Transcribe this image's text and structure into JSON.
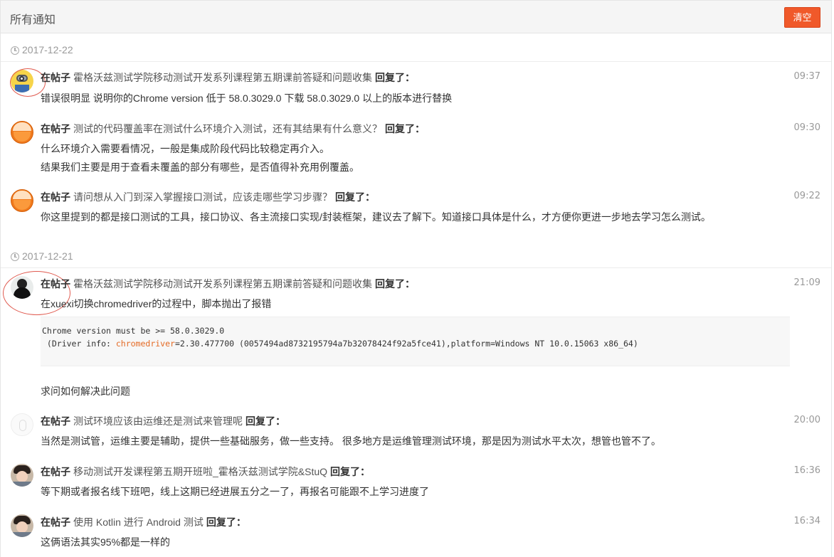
{
  "header": {
    "title": "所有通知",
    "clear_label": "清空"
  },
  "groups": [
    {
      "date": "2017-12-22"
    },
    {
      "date": "2017-12-21"
    }
  ],
  "notifications": [
    {
      "where": "在帖子",
      "topic": "霍格沃兹测试学院移动测试开发系列课程第五期课前答疑和问题收集",
      "verb": "回复了：",
      "time": "09:37",
      "reply": [
        "错误很明显 说明你的Chrome version 低于 58.0.3029.0 下载 58.0.3029.0 以上的版本进行替换"
      ],
      "avatar": "minion-avatar"
    },
    {
      "where": "在帖子",
      "topic": "测试的代码覆盖率在测试什么环境介入测试，还有其结果有什么意义？",
      "verb": "回复了：",
      "time": "09:30",
      "reply": [
        "什么环境介入需要看情况，一般是集成阶段代码比较稳定再介入。",
        "结果我们主要是用于查看未覆盖的部分有哪些，是否值得补充用例覆盖。"
      ],
      "avatar": "orange-avatar"
    },
    {
      "where": "在帖子",
      "topic": "请问想从入门到深入掌握接口测试，应该走哪些学习步骤？",
      "verb": "回复了：",
      "time": "09:22",
      "reply": [
        "你这里提到的都是接口测试的工具，接口协议、各主流接口实现/封装框架，建议去了解下。知道接口具体是什么，才方便你更进一步地去学习怎么测试。"
      ],
      "avatar": "orange-avatar"
    },
    {
      "where": "在帖子",
      "topic": "霍格沃兹测试学院移动测试开发系列课程第五期课前答疑和问题收集",
      "verb": "回复了：",
      "time": "21:09",
      "reply": [
        "在xuexi切换chromedriver的过程中，脚本抛出了报错"
      ],
      "code": {
        "line1": "Chrome version must be >= 58.0.3029.0",
        "line2_prefix": " (Driver info: ",
        "line2_keyword": "chromedriver",
        "line2_suffix": "=2.30.477700 (0057494ad8732195794a7b32078424f92a5fce41),platform=Windows NT 10.0.15063 x86_64)"
      },
      "reply_after": "求问如何解决此问题",
      "avatar": "dark-avatar"
    },
    {
      "where": "在帖子",
      "topic": "测试环境应该由运维还是测试来管理呢",
      "verb": "回复了：",
      "time": "20:00",
      "reply": [
        "当然是测试管，运维主要是辅助，提供一些基础服务，做一些支持。 很多地方是运维管理测试环境，那是因为测试水平太次，想管也管不了。"
      ],
      "avatar": "blank-avatar"
    },
    {
      "where": "在帖子",
      "topic": "移动测试开发课程第五期开班啦_霍格沃兹测试学院&StuQ",
      "verb": "回复了：",
      "time": "16:36",
      "reply": [
        "等下期或者报名线下班吧，线上这期已经进展五分之一了，再报名可能跟不上学习进度了"
      ],
      "avatar": "person-avatar"
    },
    {
      "where": "在帖子",
      "topic": "使用 Kotlin 进行 Android 测试",
      "verb": "回复了：",
      "time": "16:34",
      "reply": [
        "这俩语法其实95%都是一样的"
      ],
      "avatar": "person-avatar"
    }
  ]
}
